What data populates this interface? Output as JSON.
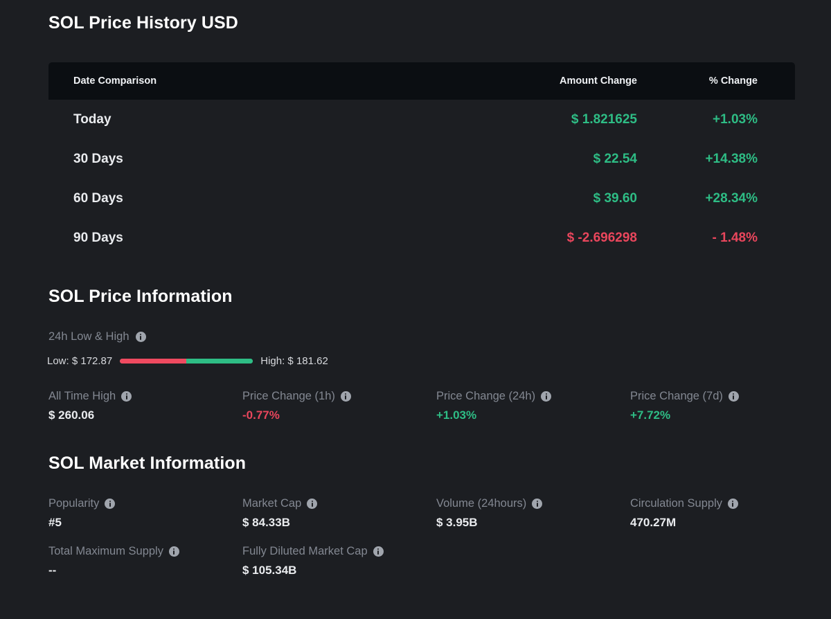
{
  "sections": {
    "history_title": "SOL Price History USD",
    "price_info_title": "SOL Price Information",
    "market_info_title": "SOL Market Information"
  },
  "history_table": {
    "columns": {
      "date": "Date Comparison",
      "amount": "Amount Change",
      "percent": "% Change"
    },
    "rows": [
      {
        "date": "Today",
        "amount": "$ 1.821625",
        "percent": "+1.03%",
        "direction": "up"
      },
      {
        "date": "30 Days",
        "amount": "$ 22.54",
        "percent": "+14.38%",
        "direction": "up"
      },
      {
        "date": "60 Days",
        "amount": "$ 39.60",
        "percent": "+28.34%",
        "direction": "up"
      },
      {
        "date": "90 Days",
        "amount": "$ -2.696298",
        "percent": "- 1.48%",
        "direction": "down"
      }
    ]
  },
  "low_high": {
    "label": "24h Low & High",
    "low_text": "Low: $ 172.87",
    "high_text": "High: $ 181.62",
    "low_value": 172.87,
    "high_value": 181.62,
    "low_segment_percent": 50
  },
  "price_info": [
    {
      "name": "All Time High",
      "value": "$ 260.06",
      "tone": "neutral"
    },
    {
      "name": "Price Change (1h)",
      "value": "-0.77%",
      "tone": "down"
    },
    {
      "name": "Price Change (24h)",
      "value": "+1.03%",
      "tone": "up"
    },
    {
      "name": "Price Change (7d)",
      "value": "+7.72%",
      "tone": "up"
    }
  ],
  "market_info_row1": [
    {
      "name": "Popularity",
      "value": "#5"
    },
    {
      "name": "Market Cap",
      "value": "$ 84.33B"
    },
    {
      "name": "Volume (24hours)",
      "value": "$ 3.95B"
    },
    {
      "name": "Circulation Supply",
      "value": "470.27M"
    }
  ],
  "market_info_row2": [
    {
      "name": "Total Maximum Supply",
      "value": "--"
    },
    {
      "name": "Fully Diluted Market Cap",
      "value": "$ 105.34B"
    }
  ],
  "colors": {
    "background": "#1c1e22",
    "header_background": "#0b0e12",
    "positive": "#2ebd85",
    "negative": "#e9465c",
    "muted_text": "#838892",
    "value_text": "#eaecef"
  },
  "icons": {
    "info": "info-icon"
  }
}
